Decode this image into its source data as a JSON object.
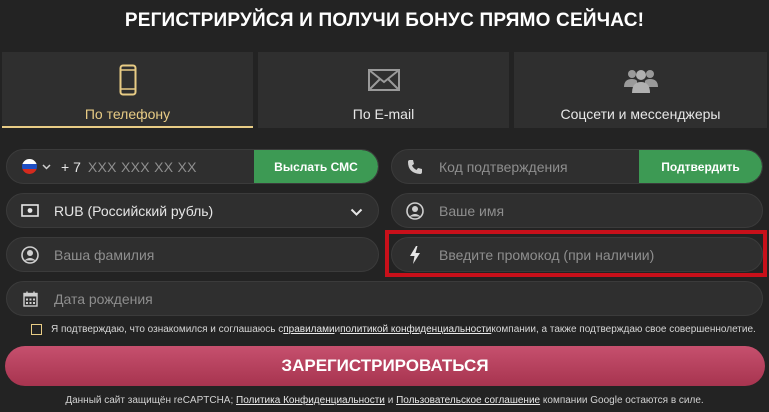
{
  "header": {
    "title": "РЕГИСТРИРУЙСЯ И ПОЛУЧИ БОНУС ПРЯМО СЕЙЧАС!"
  },
  "tabs": [
    {
      "label": "По телефону",
      "icon": "phone-icon",
      "active": true
    },
    {
      "label": "По E-mail",
      "icon": "envelope-icon"
    },
    {
      "label": "Соцсети и мессенджеры",
      "icon": "users-icon"
    }
  ],
  "phone": {
    "country_code": "+ 7",
    "placeholder": "XXX XXX XX XX",
    "send_sms_label": "Выслать СМС",
    "flag_icon": "russia-flag-icon"
  },
  "confirm": {
    "placeholder": "Код подтверждения",
    "button_label": "Подтвердить"
  },
  "currency": {
    "value": "RUB (Российский рубль)"
  },
  "name": {
    "placeholder": "Ваше имя"
  },
  "surname": {
    "placeholder": "Ваша фамилия"
  },
  "promo": {
    "placeholder": "Введите промокод (при наличии)"
  },
  "dob": {
    "placeholder": "Дата рождения"
  },
  "agree": {
    "text_1": "Я подтверждаю, что ознакомился и соглашаюсь с ",
    "rules_link": "правилами",
    "text_2": " и ",
    "privacy_link": "политикой конфиденциальности",
    "text_3": " компании, а также подтверждаю свое совершеннолетие."
  },
  "register": {
    "label": "ЗАРЕГИСТРИРОВАТЬСЯ"
  },
  "recaptcha": {
    "text_1": "Данный сайт защищён reCAPTCHA; ",
    "privacy_link": "Политика Конфиденциальности",
    "text_2": " и ",
    "terms_link": "Пользовательское соглашение",
    "text_3": " компании Google остаются в силе."
  },
  "colors": {
    "accent_gold": "#e8cc85",
    "green": "#3d9a54",
    "register_pink": "#b8415f",
    "highlight_red": "#c8101a"
  }
}
